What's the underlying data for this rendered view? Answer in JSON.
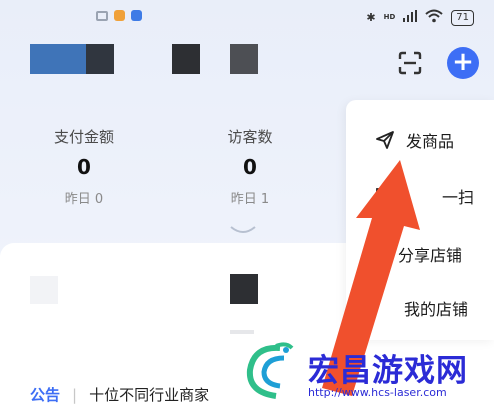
{
  "status_bar": {
    "battery": "71",
    "signal_label": "HD"
  },
  "stats": [
    {
      "label": "支付金额",
      "value": "0",
      "yesterday": "昨日 0"
    },
    {
      "label": "访客数",
      "value": "0",
      "yesterday": "昨日 1"
    }
  ],
  "header": {
    "add_label": "+"
  },
  "menu": {
    "items": [
      {
        "label": "发商品",
        "icon": "send-icon"
      },
      {
        "label": "一扫",
        "icon": "scan-icon"
      },
      {
        "label": "分享店铺",
        "icon": "share-icon"
      },
      {
        "label": "我的店铺",
        "icon": "store-icon"
      }
    ]
  },
  "notice": {
    "tag": "公告",
    "text": "十位不同行业商家"
  },
  "watermark": {
    "title": "宏昌游戏网",
    "url": "http://www.hcs-laser.com"
  },
  "colors": {
    "accent": "#3d6ef5",
    "arrow": "#f0502d",
    "watermark": "#2b2bd6"
  }
}
